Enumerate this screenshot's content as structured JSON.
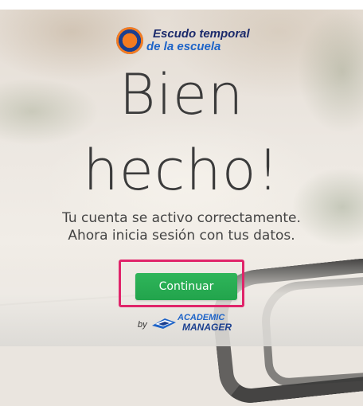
{
  "logo": {
    "line1": "Escudo temporal",
    "line2": "de la escuela"
  },
  "headline": {
    "line1": "Bien",
    "line2": "hecho!"
  },
  "message": {
    "line1": "Tu cuenta se activo correctamente.",
    "line2": "Ahora inicia sesión con tus datos."
  },
  "button": {
    "label": "Continuar"
  },
  "powered_by": {
    "by": "by",
    "brand_line1": "ACADEMIC",
    "brand_line2": "MANAGER"
  },
  "colors": {
    "button": "#22a44c",
    "highlight": "#e0246a",
    "brand_dark": "#1b2a6b",
    "brand_blue": "#1e64c8",
    "brand_orange": "#f47b20"
  }
}
